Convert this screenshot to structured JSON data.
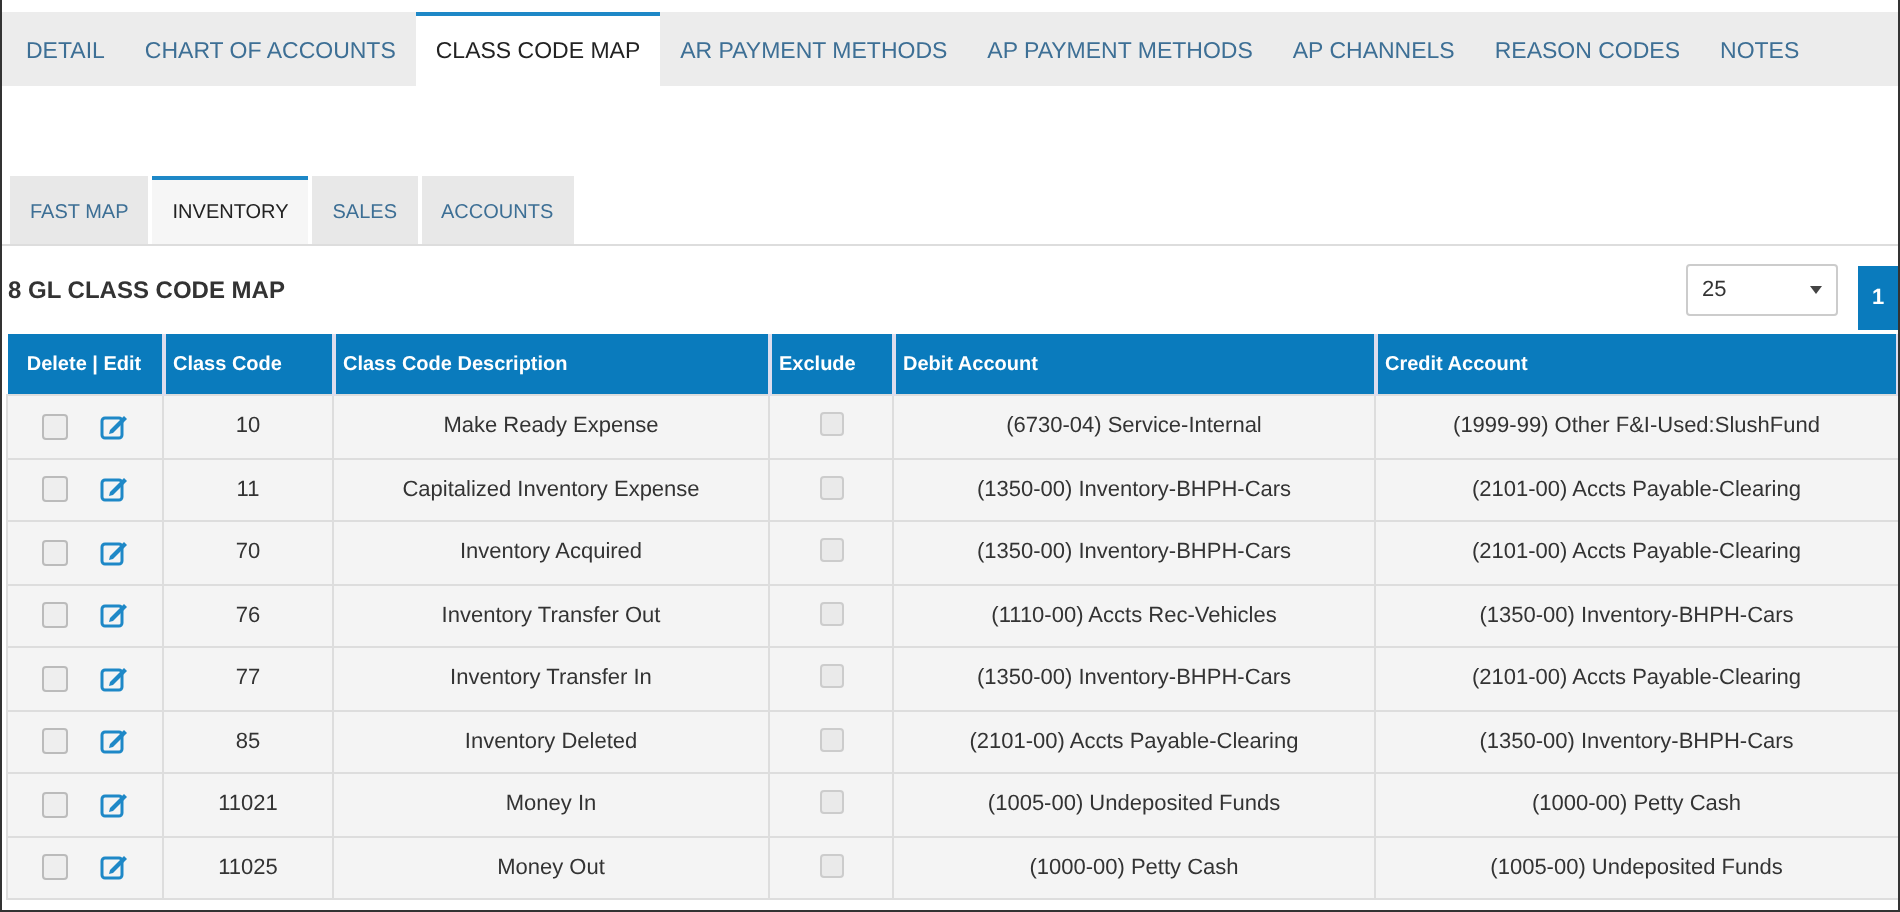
{
  "tabs": [
    {
      "label": "DETAIL",
      "selected": false
    },
    {
      "label": "CHART OF ACCOUNTS",
      "selected": false
    },
    {
      "label": "CLASS CODE MAP",
      "selected": true
    },
    {
      "label": "AR PAYMENT METHODS",
      "selected": false
    },
    {
      "label": "AP PAYMENT METHODS",
      "selected": false
    },
    {
      "label": "AP CHANNELS",
      "selected": false
    },
    {
      "label": "REASON CODES",
      "selected": false
    },
    {
      "label": "NOTES",
      "selected": false
    }
  ],
  "subtabs": [
    {
      "label": "FAST MAP",
      "selected": false
    },
    {
      "label": "INVENTORY",
      "selected": true
    },
    {
      "label": "SALES",
      "selected": false
    },
    {
      "label": "ACCOUNTS",
      "selected": false
    }
  ],
  "title": "8 GL CLASS CODE MAP",
  "page_size": {
    "value": "25"
  },
  "pagination": [
    {
      "label": "1",
      "selected": true
    }
  ],
  "table": {
    "columns": [
      "Delete | Edit",
      "Class Code",
      "Class Code Description",
      "Exclude",
      "Debit Account",
      "Credit Account"
    ],
    "rows": [
      {
        "checked": false,
        "code": "10",
        "description": "Make Ready Expense",
        "exclude": false,
        "debit": "(6730-04) Service-Internal",
        "credit": "(1999-99) Other F&I-Used:SlushFund"
      },
      {
        "checked": false,
        "code": "11",
        "description": "Capitalized Inventory Expense",
        "exclude": false,
        "debit": "(1350-00) Inventory-BHPH-Cars",
        "credit": "(2101-00) Accts Payable-Clearing"
      },
      {
        "checked": false,
        "code": "70",
        "description": "Inventory Acquired",
        "exclude": false,
        "debit": "(1350-00) Inventory-BHPH-Cars",
        "credit": "(2101-00) Accts Payable-Clearing"
      },
      {
        "checked": false,
        "code": "76",
        "description": "Inventory Transfer Out",
        "exclude": false,
        "debit": "(1110-00) Accts Rec-Vehicles",
        "credit": "(1350-00) Inventory-BHPH-Cars"
      },
      {
        "checked": false,
        "code": "77",
        "description": "Inventory Transfer In",
        "exclude": false,
        "debit": "(1350-00) Inventory-BHPH-Cars",
        "credit": "(2101-00) Accts Payable-Clearing"
      },
      {
        "checked": false,
        "code": "85",
        "description": "Inventory Deleted",
        "exclude": false,
        "debit": "(2101-00) Accts Payable-Clearing",
        "credit": "(1350-00) Inventory-BHPH-Cars"
      },
      {
        "checked": false,
        "code": "11021",
        "description": "Money In",
        "exclude": false,
        "debit": "(1005-00) Undeposited Funds",
        "credit": "(1000-00) Petty Cash"
      },
      {
        "checked": false,
        "code": "11025",
        "description": "Money Out",
        "exclude": false,
        "debit": "(1000-00) Petty Cash",
        "credit": "(1005-00) Undeposited Funds"
      }
    ]
  }
}
